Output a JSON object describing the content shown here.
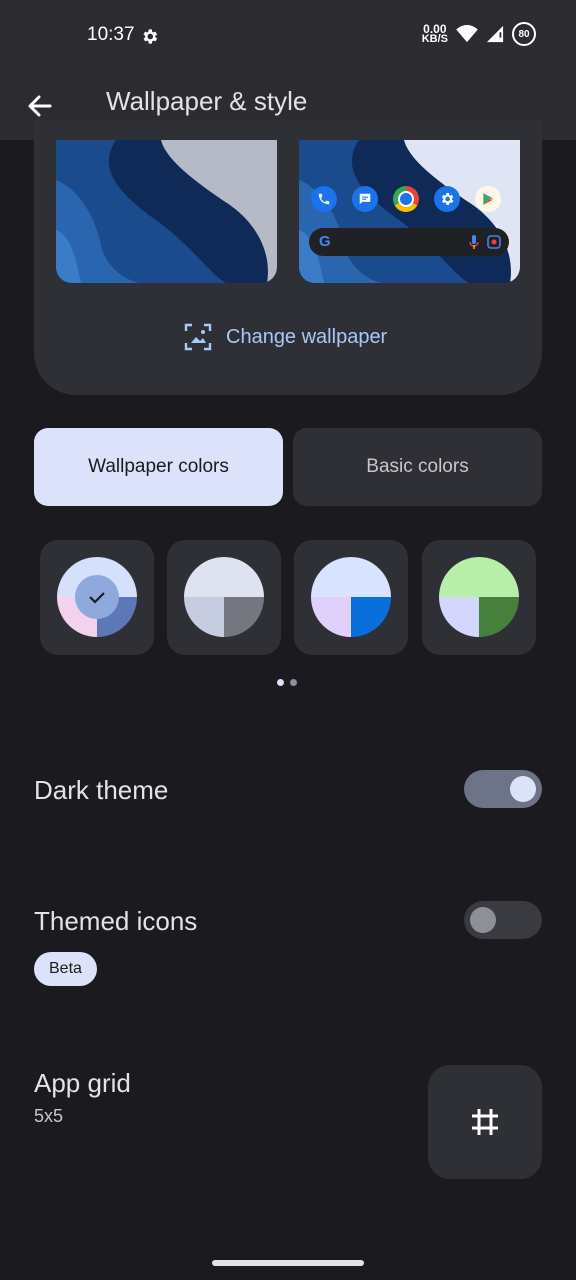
{
  "status_bar": {
    "time": "10:37",
    "net_speed_value": "0.00",
    "net_speed_unit": "KB/S",
    "battery": "80",
    "icons": [
      "settings-gear-icon",
      "wifi-icon",
      "signal-icon",
      "battery-icon"
    ]
  },
  "app_bar": {
    "title": "Wallpaper & style",
    "back_icon": "arrow-back-icon"
  },
  "preview": {
    "change_wallpaper_label": "Change wallpaper",
    "change_wallpaper_icon": "image-crop-icon",
    "home_apps": [
      "phone-icon",
      "messages-icon",
      "chrome-icon",
      "settings-icon",
      "play-store-icon"
    ]
  },
  "color_tabs": {
    "wallpaper_colors": "Wallpaper colors",
    "basic_colors": "Basic colors",
    "selected": "Wallpaper colors"
  },
  "swatches": [
    {
      "selected": true,
      "colors": [
        "#d5e1fb",
        "#f2d2ec",
        "#5c78b6"
      ],
      "center": "#8fa9dd"
    },
    {
      "selected": false,
      "colors": [
        "#dfe3f0",
        "#c7cde0",
        "#757780"
      ]
    },
    {
      "selected": false,
      "colors": [
        "#d8e3ff",
        "#dfd1fb",
        "#0a6fdd"
      ]
    },
    {
      "selected": false,
      "colors": [
        "#b7efa8",
        "#d3d7ff",
        "#477f3d"
      ]
    }
  ],
  "pager": {
    "pages": 2,
    "current": 1
  },
  "dark_theme": {
    "label": "Dark theme",
    "enabled": true
  },
  "themed_icons": {
    "label": "Themed icons",
    "badge": "Beta",
    "enabled": false
  },
  "app_grid": {
    "label": "App grid",
    "value": "5x5",
    "icon": "grid-hash-icon"
  },
  "colors": {
    "background": "#1b1b1f",
    "surface": "#2f3035",
    "accent": "#a8c7fa",
    "selected_tab": "#dbe2f9"
  }
}
